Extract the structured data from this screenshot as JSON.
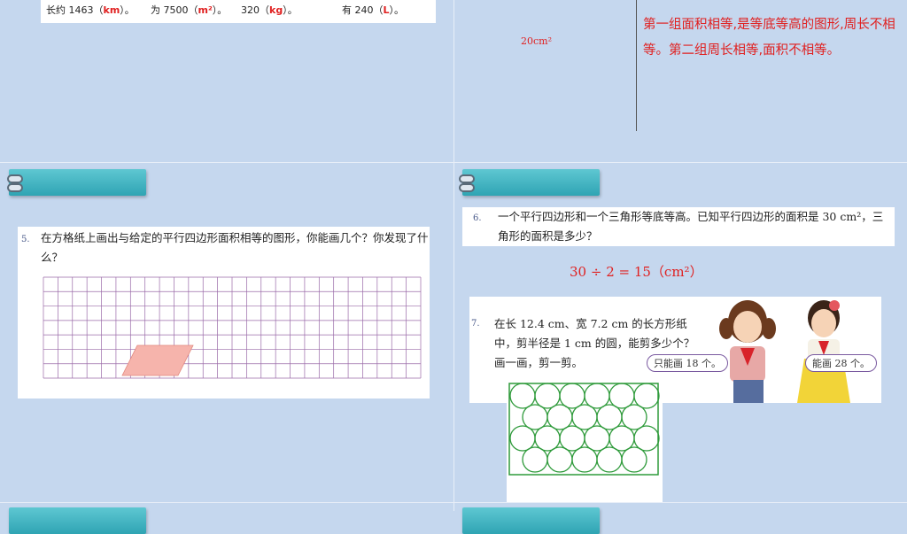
{
  "top_left": {
    "item1": {
      "prefix": "长约 1463（",
      "answer": "km",
      "suffix": "）。"
    },
    "item2": {
      "prefix": "为 7500（",
      "answer": "m²",
      "suffix": "）。"
    },
    "item3": {
      "prefix": "320（",
      "answer": "kg",
      "suffix": "）。"
    },
    "item4": {
      "prefix": "有 240（",
      "answer": "L",
      "suffix": "）。"
    }
  },
  "top_right": {
    "area_value": "20cm²",
    "explanation": "第一组面积相等,是等底等高的图形,周长不相等。第二组周长相等,面积不相等。"
  },
  "q5": {
    "number": "5.",
    "text": "在方格纸上画出与给定的平行四边形面积相等的图形，你能画几个？你发现了什么？"
  },
  "q6": {
    "number": "6.",
    "text": "一个平行四边形和一个三角形等底等高。已知平行四边形的面积是 30 cm²，三角形的面积是多少？",
    "answer": "30 ÷ 2 = 15（cm²）"
  },
  "q7": {
    "number": "7.",
    "text": "在长 12.4 cm、宽 7.2 cm 的长方形纸中，剪半径是 1 cm 的圆，能剪多少个？画一画，剪一剪。",
    "bubble_left": "只能画 18 个。",
    "bubble_right": "能画 28 个。"
  },
  "colors": {
    "background": "#c5d7ee",
    "tab": "#3fb3c0",
    "answer_red": "#e02020",
    "grid_line": "#9a6aa8",
    "parallelogram": "#f6b4ac",
    "circle": "#2e9a3a"
  }
}
